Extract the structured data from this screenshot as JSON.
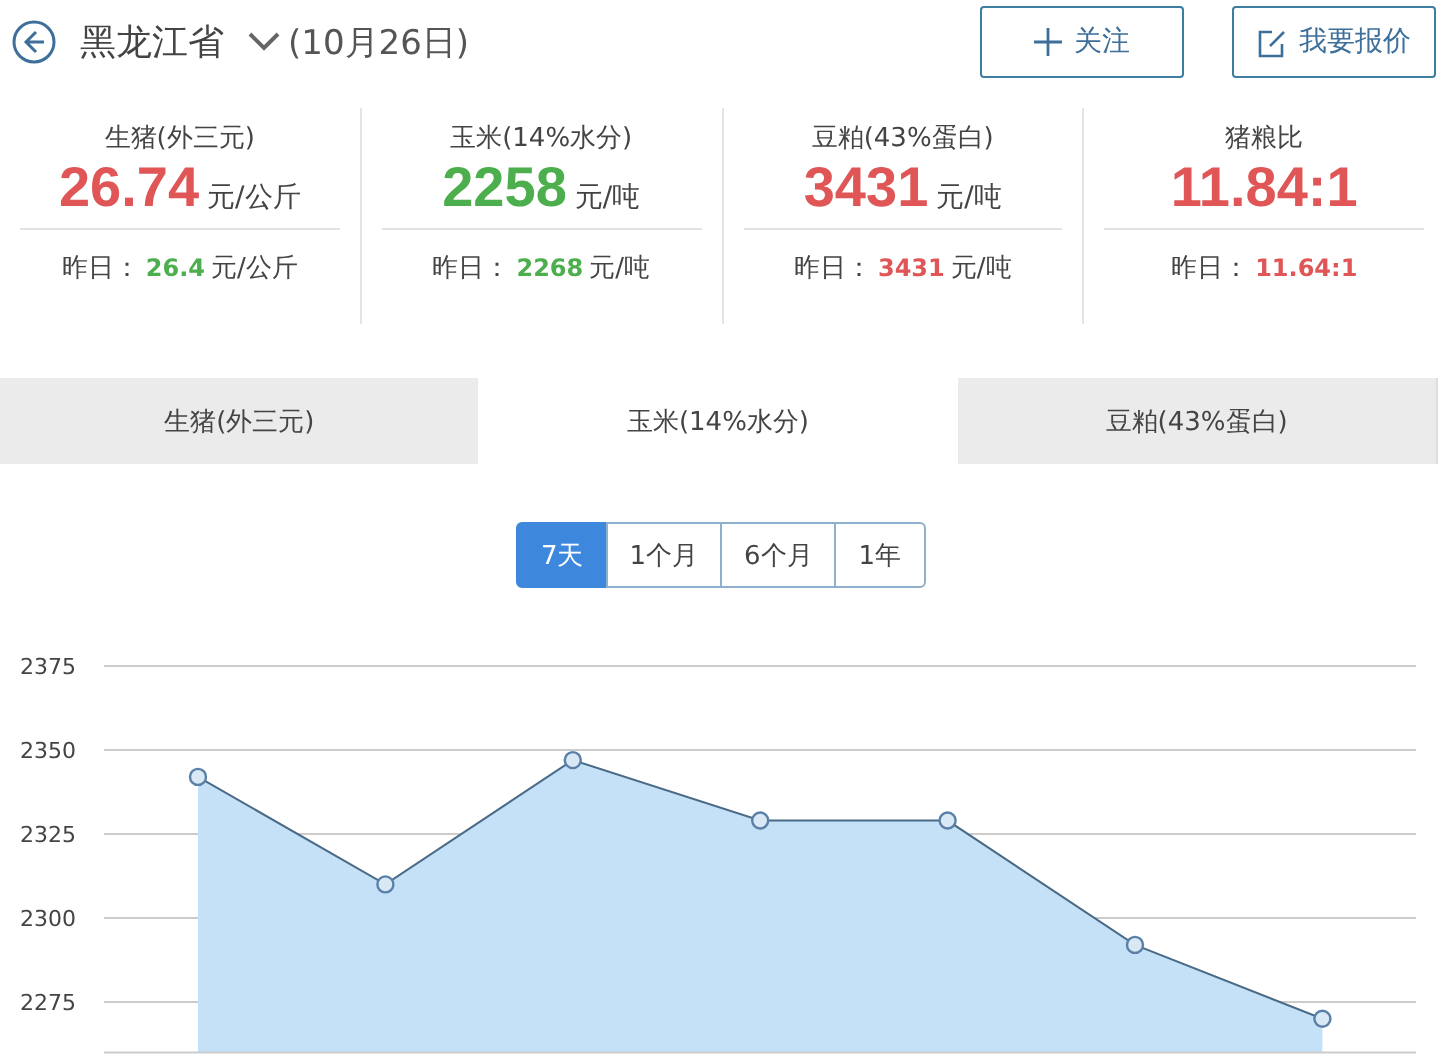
{
  "header": {
    "region": "黑龙江省",
    "date": "(10月26日)",
    "buttons": [
      {
        "kind": "follow",
        "label": "关注"
      },
      {
        "kind": "quote",
        "label": "我要报价"
      }
    ]
  },
  "stats": [
    {
      "label": "生猪(外三元)",
      "value": {
        "text": "26.74",
        "color": "#e05656"
      },
      "unit": "元/公斤",
      "yesterday_label": "昨日：",
      "yesterday": {
        "text": "26.4",
        "color": "#4cae4c"
      },
      "yesterday_unit": "元/公斤"
    },
    {
      "label": "玉米(14%水分)",
      "value": {
        "text": "2258",
        "color": "#4cae4c"
      },
      "unit": "元/吨",
      "yesterday_label": "昨日：",
      "yesterday": {
        "text": "2268",
        "color": "#4cae4c"
      },
      "yesterday_unit": "元/吨"
    },
    {
      "label": "豆粕(43%蛋白)",
      "value": {
        "text": "3431",
        "color": "#e05656"
      },
      "unit": "元/吨",
      "yesterday_label": "昨日：",
      "yesterday": {
        "text": "3431",
        "color": "#e05656"
      },
      "yesterday_unit": "元/吨"
    },
    {
      "label": "猪粮比",
      "value": {
        "text": "11.84:1",
        "color": "#e05656"
      },
      "yesterday_label": "昨日：",
      "yesterday": {
        "text": "11.64:1",
        "color": "#e05656"
      }
    }
  ],
  "tabs": [
    {
      "label": "生猪(外三元)",
      "selected": false
    },
    {
      "label": "玉米(14%水分)",
      "selected": true
    },
    {
      "label": "豆粕(43%蛋白)",
      "selected": false
    }
  ],
  "ranges": [
    {
      "label": "7天",
      "selected": true
    },
    {
      "label": "1个月",
      "selected": false
    },
    {
      "label": "6个月",
      "selected": false
    },
    {
      "label": "1年",
      "selected": false
    }
  ],
  "chart_data": {
    "type": "area",
    "series": [
      {
        "color": "#c5e1f7",
        "values": [
          2342,
          2310,
          2347,
          2329,
          2329,
          2292,
          2270
        ]
      }
    ],
    "ylim": [
      2260,
      2375
    ],
    "yticks": [
      2275,
      2300,
      2325,
      2350,
      2375
    ],
    "grid": true
  }
}
